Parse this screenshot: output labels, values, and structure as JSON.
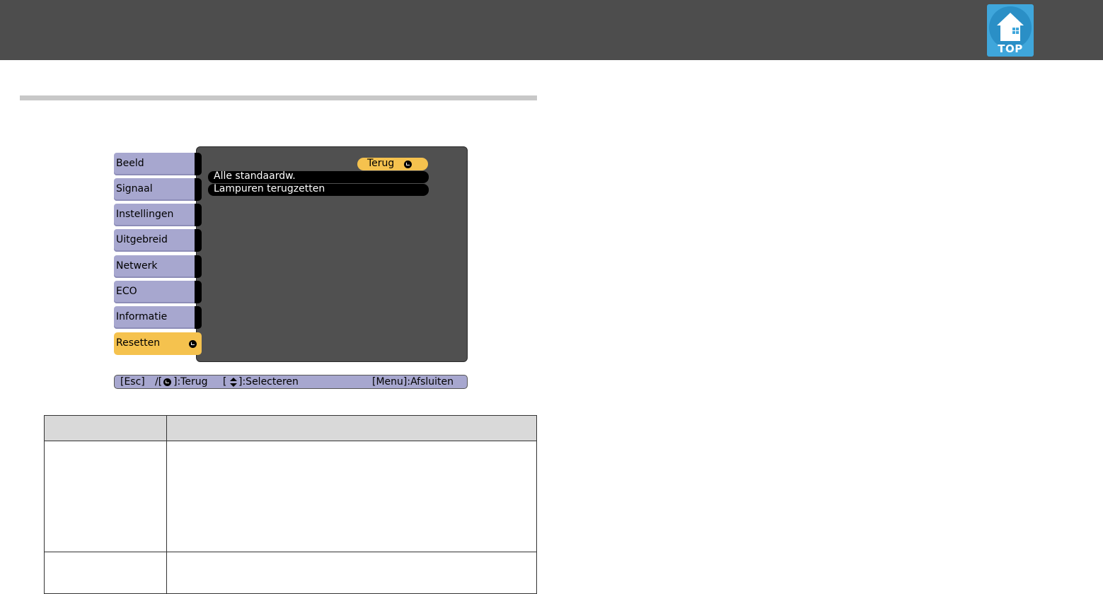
{
  "header": {
    "top_button_label": "TOP"
  },
  "menu": {
    "tabs": [
      {
        "label": "Beeld"
      },
      {
        "label": "Signaal"
      },
      {
        "label": "Instellingen"
      },
      {
        "label": "Uitgebreid"
      },
      {
        "label": "Netwerk"
      },
      {
        "label": "ECO"
      },
      {
        "label": "Informatie"
      },
      {
        "label": "Resetten",
        "active": true
      }
    ],
    "back_button_label": "Terug",
    "items": [
      {
        "label": "Alle standaardw."
      },
      {
        "label": "Lampuren terugzetten"
      }
    ]
  },
  "help_bar": {
    "esc": "[Esc]",
    "slash_open": "/[",
    "back": "]:Terug",
    "select_open": "[",
    "select": "]:Selecteren",
    "exit": "[Menu]:Afsluiten"
  },
  "colors": {
    "header_bg": "#4d4d4d",
    "tab_bg": "#a7a7cf",
    "active_tab_bg": "#f5c24e",
    "panel_bg": "#505050",
    "top_button_bg": "#3fa6db",
    "table_header_bg": "#d9d9d9"
  },
  "icons": {
    "top_button": "house-icon",
    "enter": "enter-icon",
    "updown": "up-down-arrow-icon"
  }
}
